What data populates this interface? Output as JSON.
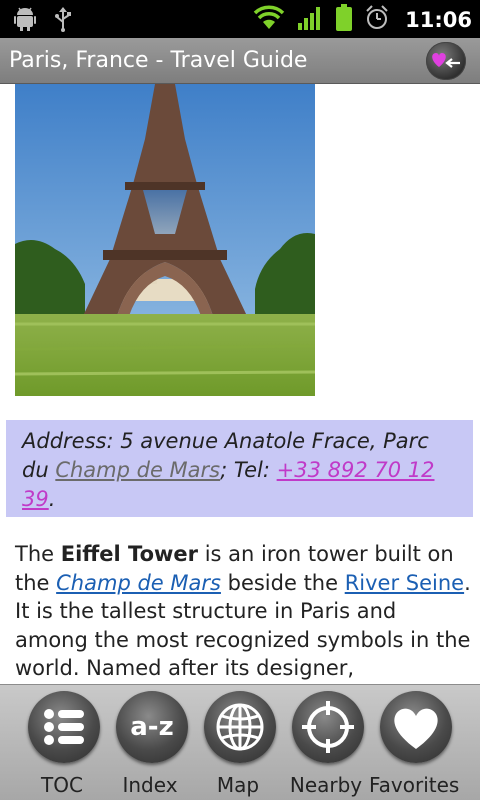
{
  "status_bar": {
    "time": "11:06",
    "icons": [
      "android-debug-icon",
      "usb-icon",
      "wifi-icon",
      "signal-icon",
      "battery-icon",
      "alarm-icon"
    ]
  },
  "title_bar": {
    "title": "Paris, France - Travel Guide",
    "action_icon": "favorites-back-icon"
  },
  "article": {
    "image_subject": "Eiffel Tower",
    "address": {
      "prefix": "Address: 5 avenue Anatole Frace, Parc du ",
      "link": "Champ de Mars",
      "tel_label": "; Tel: ",
      "phone": "+33 892 70 12 39",
      "suffix": "."
    },
    "paragraph": {
      "t1": "The ",
      "bold": "Eiffel Tower",
      "t2": " is an iron tower built on the ",
      "link1": "Champ de Mars",
      "t3": " beside the ",
      "link2": "River Seine",
      "t4": ". It is the tallest structure in Paris and among the most recognized symbols in the world. Named after its designer,"
    }
  },
  "toolbar": {
    "items": [
      {
        "label": "TOC",
        "icon": "list-icon"
      },
      {
        "label": "Index",
        "icon": "a-z-icon",
        "icon_text": "a-z"
      },
      {
        "label": "Map",
        "icon": "globe-icon"
      },
      {
        "label": "Nearby",
        "icon": "crosshair-icon"
      },
      {
        "label": "Favorites",
        "icon": "heart-icon"
      }
    ]
  }
}
